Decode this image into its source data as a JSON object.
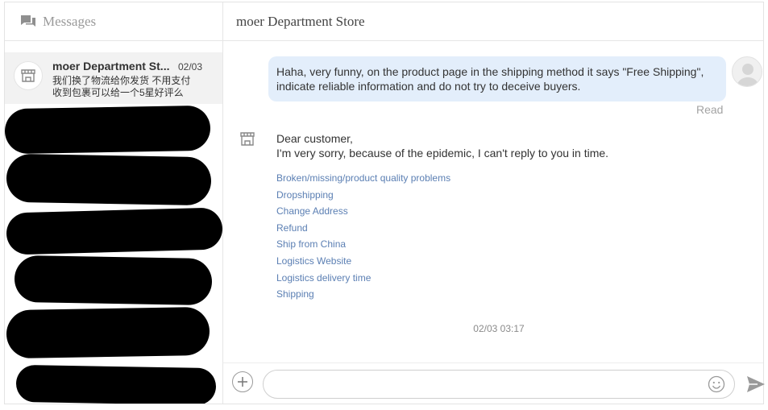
{
  "sidebar": {
    "title": "Messages",
    "conversations": [
      {
        "name": "moer Department St...",
        "date": "02/03",
        "preview_line1": "我们换了物流给你发货 不用支付",
        "preview_line2": "收到包裹可以给一个5星好评么"
      }
    ]
  },
  "chat": {
    "title": "moer Department Store",
    "messages": {
      "outgoing_text": "Haha, very funny, on the product page in the shipping method it says \"Free Shipping\", indicate reliable information and do not try to deceive buyers.",
      "read_status": "Read",
      "reply_line1": "Dear customer,",
      "reply_line2": "I'm very sorry, because of the epidemic, I can't reply to you in time.",
      "quick_links": [
        "Broken/missing/product quality problems",
        "Dropshipping",
        "Change Address",
        "Refund",
        "Ship from China",
        "Logistics Website",
        "Logistics delivery time",
        "Shipping"
      ],
      "timestamp": "02/03 03:17"
    }
  },
  "composer": {
    "placeholder": ""
  },
  "icons": {
    "messages": "chat-bubbles-icon",
    "store": "store-icon",
    "add": "plus-icon",
    "emoji": "emoji-icon",
    "send": "send-icon",
    "avatar": "user-avatar-icon"
  },
  "colors": {
    "bubble": "#e3eefb",
    "link": "#5b7fb3",
    "selected_row": "#f2f2f2"
  }
}
